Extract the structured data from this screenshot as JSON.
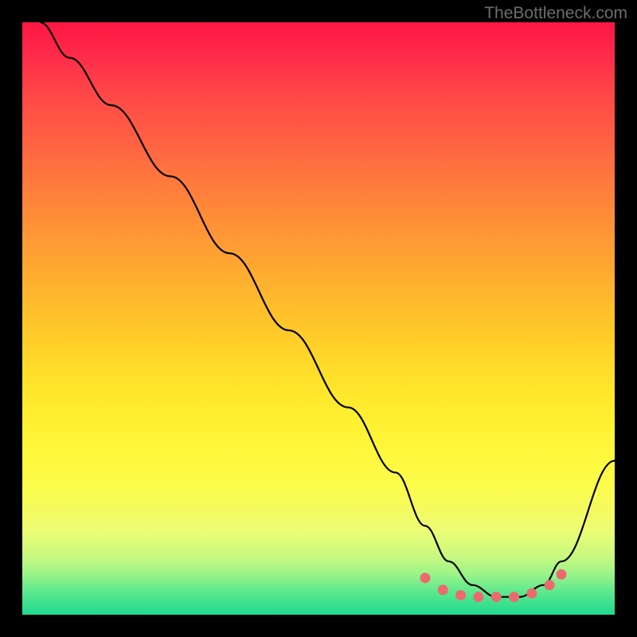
{
  "watermark": "TheBottleneck.com",
  "chart_data": {
    "type": "line",
    "title": "",
    "xlabel": "",
    "ylabel": "",
    "xlim": [
      0,
      100
    ],
    "ylim": [
      0,
      100
    ],
    "grid": false,
    "series": [
      {
        "name": "bottleneck-curve",
        "x": [
          3,
          8,
          15,
          25,
          35,
          45,
          55,
          63,
          68,
          72,
          76,
          80,
          84,
          88,
          91,
          100
        ],
        "y": [
          100,
          94,
          86,
          74,
          61,
          48,
          35,
          24,
          15,
          9,
          5,
          3,
          3,
          5,
          9,
          26
        ]
      }
    ],
    "markers": {
      "name": "valley-dots",
      "color": "#ec6a6e",
      "x": [
        68,
        71,
        74,
        77,
        80,
        83,
        86,
        89,
        91
      ],
      "y": [
        6.2,
        4.2,
        3.3,
        3.0,
        3.0,
        3.0,
        3.6,
        5.0,
        6.8
      ]
    },
    "gradient_stops": [
      {
        "pos": 0,
        "color": "#ff1744"
      },
      {
        "pos": 50,
        "color": "#ffbd2c"
      },
      {
        "pos": 75,
        "color": "#fdfc4a"
      },
      {
        "pos": 100,
        "color": "#1fd98f"
      }
    ]
  }
}
